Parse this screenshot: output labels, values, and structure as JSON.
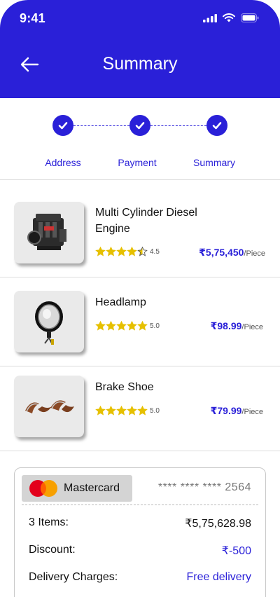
{
  "status_bar": {
    "time": "9:41"
  },
  "header": {
    "title": "Summary"
  },
  "stepper": {
    "steps": [
      {
        "label": "Address"
      },
      {
        "label": "Payment"
      },
      {
        "label": "Summary"
      }
    ]
  },
  "products": [
    {
      "name": "Multi Cylinder Diesel Engine",
      "rating": "4.5",
      "rating_value": 4.5,
      "price": "₹5,75,450",
      "unit": "/Piece"
    },
    {
      "name": "Headlamp",
      "rating": "5.0",
      "rating_value": 5,
      "price": "₹98.99",
      "unit": "/Piece"
    },
    {
      "name": "Brake Shoe",
      "rating": "5.0",
      "rating_value": 5,
      "price": "₹79.99",
      "unit": "/Piece"
    }
  ],
  "payment": {
    "method": "Mastercard",
    "card_number": "**** **** **** 2564",
    "rows": [
      {
        "label": "3 Items:",
        "value": "₹5,75,628.98"
      },
      {
        "label": "Discount:",
        "value": "₹-500"
      },
      {
        "label": "Delivery Charges:",
        "value": "Free delivery"
      }
    ]
  },
  "colors": {
    "primary": "#2a20d8",
    "star": "#e6c000"
  }
}
